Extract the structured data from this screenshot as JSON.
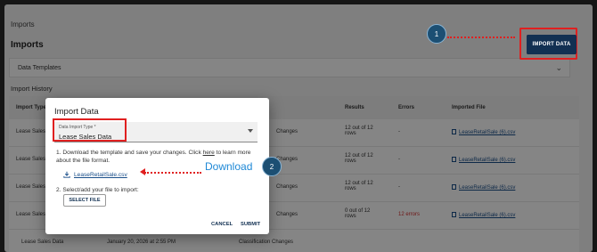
{
  "header": {
    "breadcrumb": "Imports",
    "title": "Imports",
    "import_button": "IMPORT DATA"
  },
  "templates": {
    "label": "Data Templates",
    "chevron_icon": "chevron-down-icon"
  },
  "history": {
    "title": "Import History",
    "columns": [
      "Import Type",
      "",
      "",
      "Results",
      "Errors",
      "Imported File"
    ],
    "rows": [
      {
        "type": "Lease Sales",
        "date": "",
        "kind": "Changes",
        "results": "12 out of 12 rows",
        "errors": "-",
        "file": "LeaseRetailSale (6).csv"
      },
      {
        "type": "Lease Sales",
        "date": "",
        "kind": "Changes",
        "results": "12 out of 12 rows",
        "errors": "-",
        "file": "LeaseRetailSale (6).csv"
      },
      {
        "type": "Lease Sales",
        "date": "",
        "kind": "Changes",
        "results": "12 out of 12 rows",
        "errors": "-",
        "file": "LeaseRetailSale (6).csv"
      },
      {
        "type": "Lease Sales",
        "date": "",
        "kind": "Changes",
        "results": "0 out of 12 rows",
        "errors": "12 errors",
        "file": "LeaseRetailSale (6).csv"
      },
      {
        "type": "Lease Sales Data",
        "date": "January 20, 2026 at 2:55 PM",
        "kind": "Classification Changes",
        "results": "",
        "errors": "",
        "file": ""
      }
    ]
  },
  "modal": {
    "title": "Import Data",
    "select_label": "Data Import Type *",
    "select_value": "Lease Sales Data",
    "step1_pre": "1. Download the template and save your changes. Click ",
    "step1_link": "here",
    "step1_post": " to learn more about the file format.",
    "download_link": "LeaseRetailSale.csv",
    "step2": "2. Select/add your file to import:",
    "select_file": "SELECT FILE",
    "cancel": "CANCEL",
    "submit": "SUBMIT"
  },
  "annotations": {
    "badge1": "1",
    "badge2": "2",
    "download_label": "Download"
  },
  "colors": {
    "primary": "#123052",
    "highlight": "#e02020",
    "badge": "#1c4f73",
    "link": "#1a4f8a",
    "annotation_text": "#1e88d6"
  }
}
